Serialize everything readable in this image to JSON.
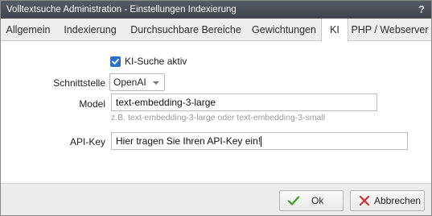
{
  "window": {
    "title": "Volltextsuche Administration - Einstellungen Indexierung",
    "help_label": "?"
  },
  "tabs": [
    {
      "label": "Allgemein"
    },
    {
      "label": "Indexierung"
    },
    {
      "label": "Durchsuchbare Bereiche"
    },
    {
      "label": "Gewichtungen"
    },
    {
      "label": "KI",
      "active": true
    },
    {
      "label": "PHP / Webserver"
    }
  ],
  "form": {
    "ki_suche": {
      "label": "KI-Suche aktiv",
      "checked": true
    },
    "schnittstelle": {
      "label": "Schnittstelle",
      "value": "OpenAI"
    },
    "model": {
      "label": "Model",
      "value": "text-embedding-3-large",
      "hint": "z.B. text-embedding-3-large oder text-embedding-3-small"
    },
    "api_key": {
      "label": "API-Key",
      "value": "Hier tragen Sie Ihren API-Key ein!"
    }
  },
  "footer": {
    "ok_label": "Ok",
    "cancel_label": "Abbrechen"
  },
  "colors": {
    "accent": "#2a6fd0",
    "ok_icon": "#3c9a28",
    "cancel_icon": "#d0312d"
  },
  "icons": {
    "ok": "checkmark-icon",
    "cancel": "x-icon",
    "checkbox": "check-icon"
  }
}
